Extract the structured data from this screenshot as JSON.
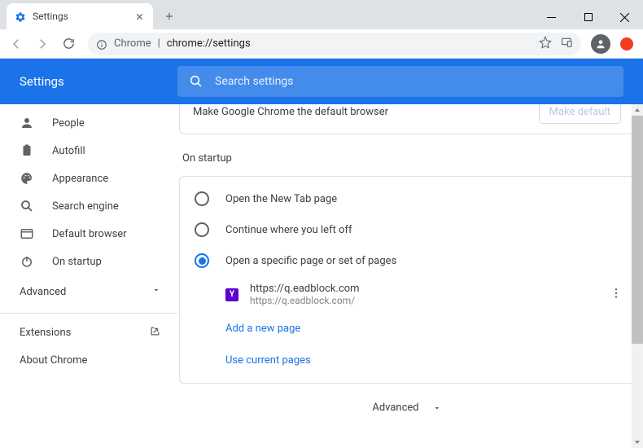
{
  "window": {
    "tab_title": "Settings",
    "new_tab_icon": "+"
  },
  "toolbar": {
    "url_host": "Chrome",
    "url_path": "chrome://settings"
  },
  "header": {
    "title": "Settings",
    "search_placeholder": "Search settings"
  },
  "sidebar": {
    "items": [
      {
        "label": "People"
      },
      {
        "label": "Autofill"
      },
      {
        "label": "Appearance"
      },
      {
        "label": "Search engine"
      },
      {
        "label": "Default browser"
      },
      {
        "label": "On startup"
      }
    ],
    "advanced": "Advanced",
    "extensions": "Extensions",
    "about": "About Chrome"
  },
  "main": {
    "default_browser_text": "Make Google Chrome the default browser",
    "make_default_button": "Make default",
    "startup_title": "On startup",
    "radio_options": [
      "Open the New Tab page",
      "Continue where you left off",
      "Open a specific page or set of pages"
    ],
    "selected_radio": 2,
    "startup_page": {
      "title": "https://q.eadblock.com",
      "url": "https://q.eadblock.com/",
      "favicon_letter": "Y"
    },
    "add_page": "Add a new page",
    "use_current": "Use current pages",
    "footer_advanced": "Advanced"
  }
}
